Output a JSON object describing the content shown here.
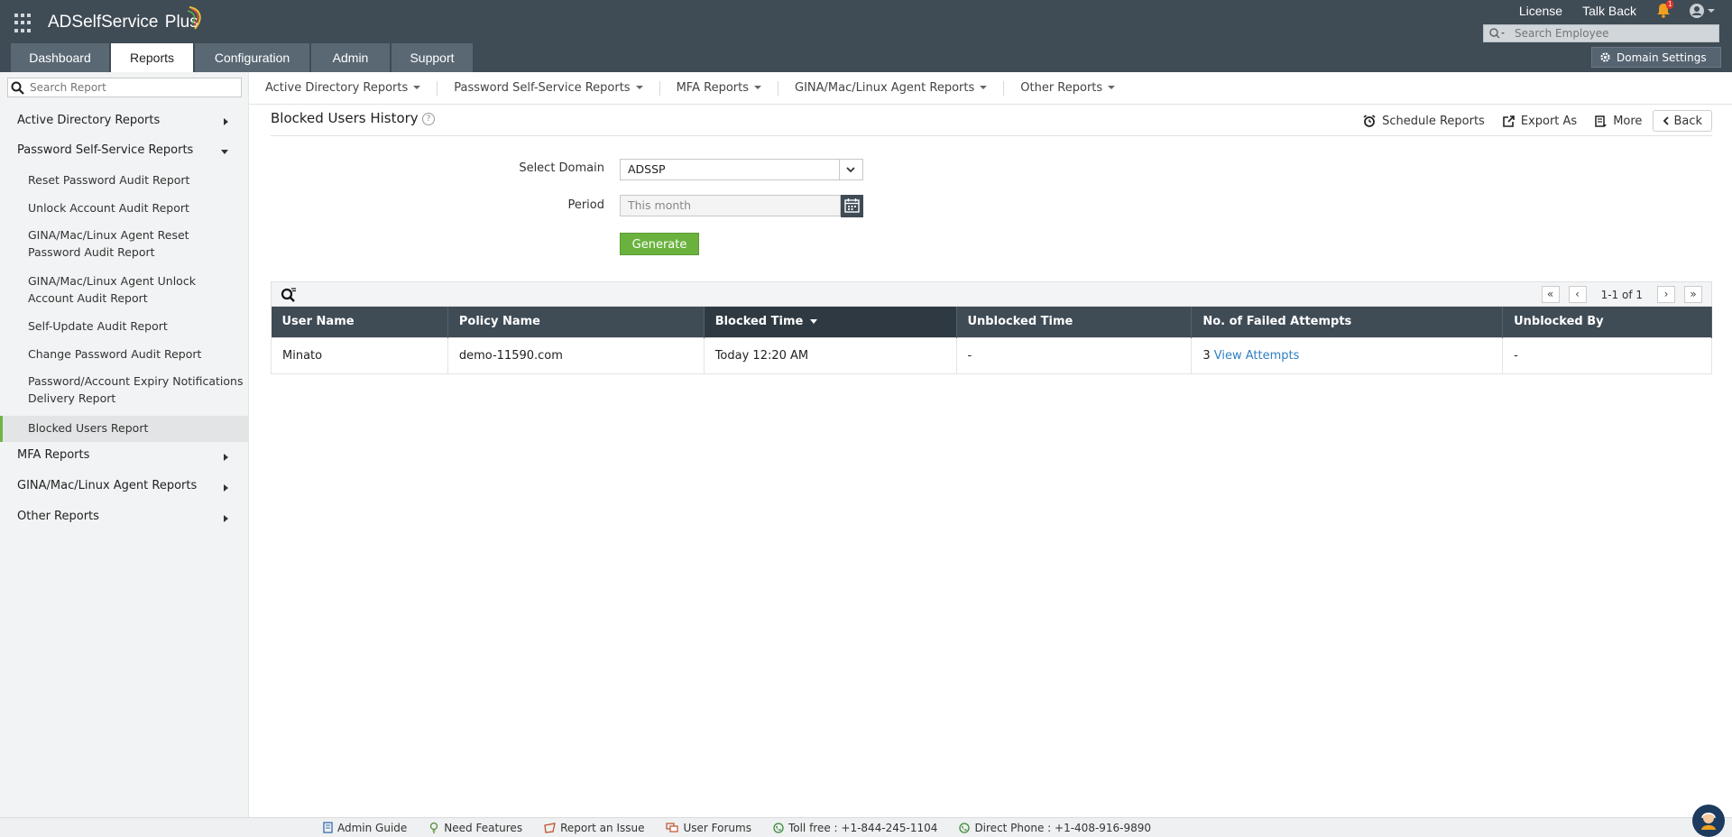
{
  "app": {
    "brand_name": "ADSelfService",
    "brand_suffix": "Plus"
  },
  "header": {
    "links": [
      "License",
      "Talk Back"
    ],
    "notification_count": "1",
    "employee_search_placeholder": "Search Employee",
    "domain_settings_label": "Domain Settings",
    "tabs": [
      "Dashboard",
      "Reports",
      "Configuration",
      "Admin",
      "Support"
    ],
    "active_tab": "Reports"
  },
  "subnav": {
    "items": [
      "Active Directory Reports",
      "Password Self-Service Reports",
      "MFA Reports",
      "GINA/Mac/Linux Agent Reports",
      "Other Reports"
    ]
  },
  "sidebar": {
    "search_placeholder": "Search Report",
    "categories": {
      "ad": "Active Directory Reports",
      "pss": "Password Self-Service Reports",
      "mfa": "MFA Reports",
      "gina": "GINA/Mac/Linux Agent Reports",
      "other": "Other Reports"
    },
    "pss_items": [
      "Reset Password Audit Report",
      "Unlock Account Audit Report",
      "GINA/Mac/Linux Agent Reset Password Audit Report",
      "GINA/Mac/Linux Agent Unlock Account Audit Report",
      "Self-Update Audit Report",
      "Change Password Audit Report",
      "Password/Account Expiry Notifications Delivery Report",
      "Blocked Users Report"
    ],
    "active_item": "Blocked Users Report"
  },
  "main": {
    "title": "Blocked Users History",
    "actions": {
      "schedule": "Schedule Reports",
      "export": "Export As",
      "more": "More",
      "back": "Back"
    },
    "form": {
      "domain_label": "Select Domain",
      "domain_value": "ADSSP",
      "period_label": "Period",
      "period_placeholder": "This month",
      "generate_label": "Generate"
    },
    "pager": {
      "range": "1-1 of 1"
    },
    "table": {
      "columns": [
        "User Name",
        "Policy Name",
        "Blocked Time",
        "Unblocked Time",
        "No. of Failed Attempts",
        "Unblocked By"
      ],
      "sorted_column": "Blocked Time",
      "rows": [
        {
          "user_name": "Minato",
          "policy_name": "demo-11590.com",
          "blocked_time": "Today 12:20 AM",
          "unblocked_time": "-",
          "failed_attempts": "3",
          "failed_attempts_link": "View Attempts",
          "unblocked_by": "-"
        }
      ]
    }
  },
  "footer": {
    "items": [
      "Admin Guide",
      "Need Features",
      "Report an Issue",
      "User Forums",
      "Toll free : +1-844-245-1104",
      "Direct Phone : +1-408-916-9890"
    ]
  },
  "colors": {
    "header_bg": "#3f4b55",
    "accent_green": "#6ab23d",
    "link_blue": "#2f7fc1",
    "notification_red": "#e0312a"
  }
}
